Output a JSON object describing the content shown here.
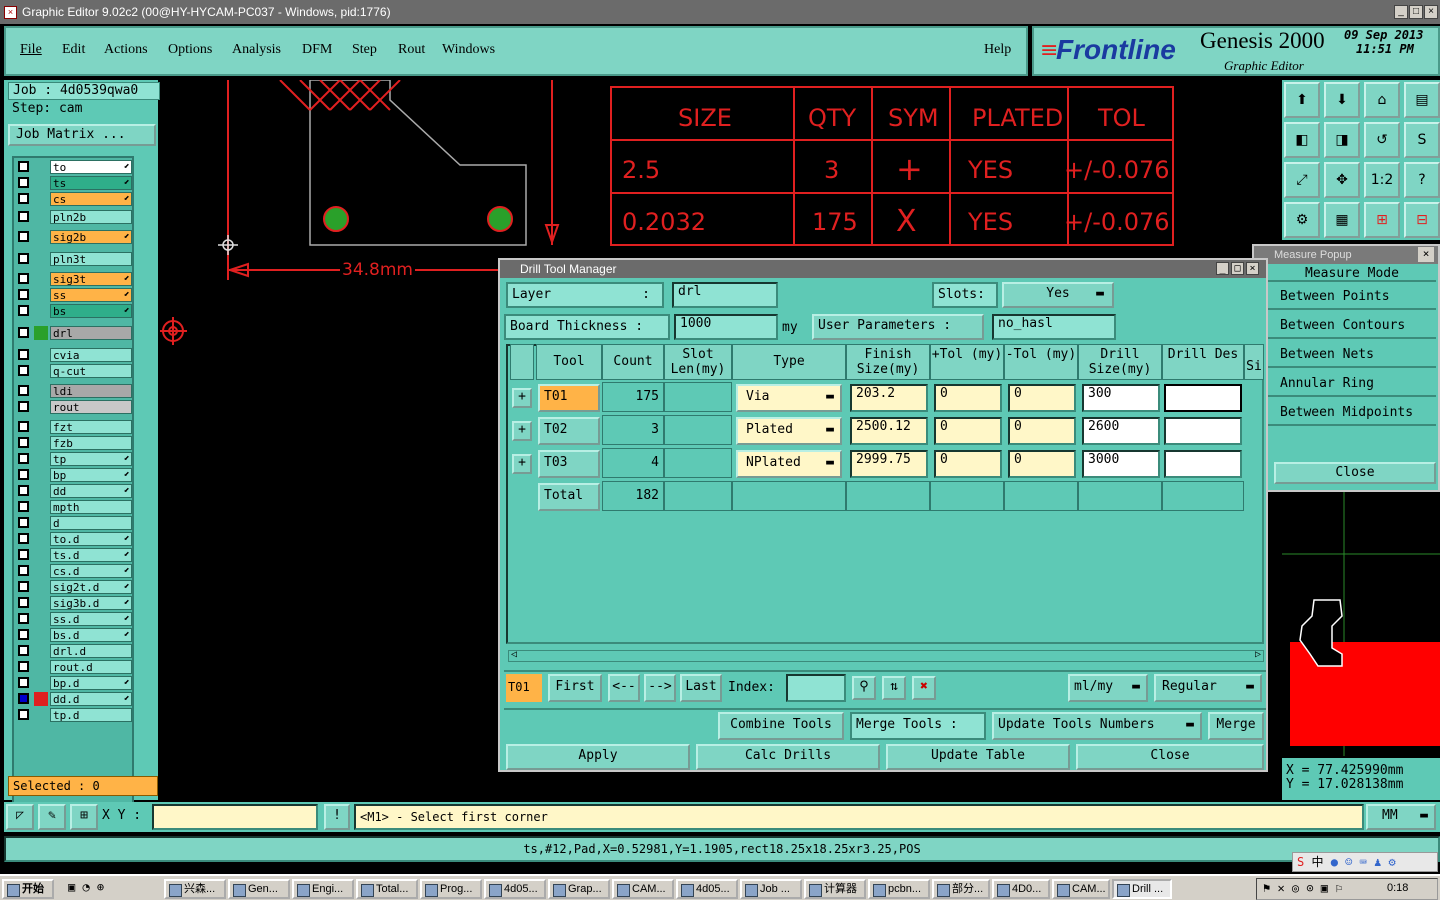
{
  "window": {
    "title": "Graphic Editor 9.02c2 (00@HY-HYCAM-PC037 - Windows, pid:1776)"
  },
  "menu": {
    "items": [
      "File",
      "Edit",
      "Actions",
      "Options",
      "Analysis",
      "DFM",
      "Step",
      "Rout",
      "Windows"
    ],
    "help": "Help"
  },
  "brand": {
    "logo": "Frontline",
    "product": "Genesis 2000",
    "subtitle": "Graphic Editor",
    "date": "09 Sep 2013",
    "time": "11:51 PM"
  },
  "job": {
    "job_line": "Job : 4d0539qwa0",
    "step_line": "Step: cam",
    "matrix_button": "Job Matrix ..."
  },
  "layers": [
    {
      "name": "to",
      "color": "#ffffff",
      "arrow": true
    },
    {
      "name": "ts",
      "color": "#2fae8a",
      "arrow": true
    },
    {
      "name": "cs",
      "color": "#ffb347",
      "arrow": true
    },
    {
      "name": "pln2b",
      "color": "",
      "arrow": false
    },
    {
      "name": "sig2b",
      "color": "#ffb347",
      "arrow": true
    },
    {
      "name": "pln3t",
      "color": "",
      "arrow": false
    },
    {
      "name": "sig3t",
      "color": "#ffb347",
      "arrow": true
    },
    {
      "name": "ss",
      "color": "#ffb347",
      "arrow": true
    },
    {
      "name": "bs",
      "color": "#2fae8a",
      "arrow": true
    },
    {
      "name": "drl",
      "color": "#a8a8a8",
      "arrow": false
    },
    {
      "name": "cvia",
      "color": "",
      "arrow": false
    },
    {
      "name": "q-cut",
      "color": "",
      "arrow": false
    },
    {
      "name": "ldi",
      "color": "#a8a8a8",
      "arrow": false
    },
    {
      "name": "rout",
      "color": "#c8c8c8",
      "arrow": false
    },
    {
      "name": "fzt",
      "color": "",
      "arrow": false
    },
    {
      "name": "fzb",
      "color": "",
      "arrow": false
    },
    {
      "name": "tp",
      "color": "",
      "arrow": true
    },
    {
      "name": "bp",
      "color": "",
      "arrow": true
    },
    {
      "name": "dd",
      "color": "",
      "arrow": true
    },
    {
      "name": "mpth",
      "color": "",
      "arrow": false
    },
    {
      "name": "d",
      "color": "",
      "arrow": false
    },
    {
      "name": "to.d",
      "color": "",
      "arrow": true
    },
    {
      "name": "ts.d",
      "color": "",
      "arrow": true
    },
    {
      "name": "cs.d",
      "color": "",
      "arrow": true
    },
    {
      "name": "sig2t.d",
      "color": "",
      "arrow": true
    },
    {
      "name": "sig3b.d",
      "color": "",
      "arrow": true
    },
    {
      "name": "ss.d",
      "color": "",
      "arrow": true
    },
    {
      "name": "bs.d",
      "color": "",
      "arrow": true
    },
    {
      "name": "drl.d",
      "color": "",
      "arrow": false
    },
    {
      "name": "rout.d",
      "color": "",
      "arrow": false
    },
    {
      "name": "bp.d",
      "color": "",
      "arrow": true
    },
    {
      "name": "dd.d",
      "color": "",
      "arrow": true
    },
    {
      "name": "tp.d",
      "color": "",
      "arrow": false
    }
  ],
  "selected": "Selected : 0",
  "drawing": {
    "dimension": "34.8mm",
    "table_headers": [
      "SIZE",
      "QTY",
      "SYM",
      "PLATED",
      "TOL"
    ],
    "table_rows": [
      [
        "2.5",
        "3",
        "+",
        "YES",
        "+/-0.076"
      ],
      [
        "0.2032",
        "175",
        "X",
        "YES",
        "+/-0.076"
      ]
    ]
  },
  "dtm": {
    "title": "Drill Tool Manager",
    "layer_label": "Layer",
    "layer_value": "drl",
    "slots_label": "Slots:",
    "slots_value": "Yes",
    "thickness_label": "Board Thickness :",
    "thickness_value": "1000",
    "thickness_unit": "my",
    "user_params_button": "User Parameters :",
    "user_params_value": "no_hasl",
    "columns": [
      "Tool",
      "Count",
      "Slot Len(my)",
      "Type",
      "Finish Size(my)",
      "+Tol (my)",
      "-Tol (my)",
      "Drill Size(my)",
      "Drill Des",
      "Si"
    ],
    "rows": [
      {
        "tool": "T01",
        "count": "175",
        "type": "Via",
        "finish": "203.2",
        "ptol": "0",
        "mtol": "0",
        "drill": "300"
      },
      {
        "tool": "T02",
        "count": "3",
        "type": "Plated",
        "finish": "2500.12",
        "ptol": "0",
        "mtol": "0",
        "drill": "2600"
      },
      {
        "tool": "T03",
        "count": "4",
        "type": "NPlated",
        "finish": "2999.75",
        "ptol": "0",
        "mtol": "0",
        "drill": "3000"
      }
    ],
    "total_label": "Total",
    "total_value": "182",
    "nav": {
      "current": "T01",
      "first": "First",
      "prev": "<--",
      "next": "-->",
      "last": "Last",
      "index_label": "Index:",
      "units": "ml/my",
      "mode": "Regular"
    },
    "actions": {
      "combine": "Combine Tools",
      "merge_label": "Merge Tools :",
      "update_numbers": "Update Tools Numbers",
      "merge": "Merge"
    },
    "bottom": {
      "apply": "Apply",
      "calc": "Calc Drills",
      "update_table": "Update Table",
      "close": "Close"
    }
  },
  "measure": {
    "title": "Measure Popup",
    "mode_label": "Measure Mode",
    "items": [
      "Between Points",
      "Between Contours",
      "Between Nets",
      "Annular Ring",
      "Between Midpoints"
    ],
    "close": "Close"
  },
  "coords": {
    "x": "X = 77.425990mm",
    "y": "Y = 17.028138mm"
  },
  "cmd": {
    "xy_label": "X Y :",
    "prompt": "<M1> - Select first corner",
    "units": "MM"
  },
  "status": "ts,#12,Pad,X=0.52981,Y=1.1905,rect18.25x18.25xr3.25,POS",
  "taskbar": {
    "start": "开始",
    "tasks": [
      "兴森...",
      "Gen...",
      "Engi...",
      "Total...",
      "Prog...",
      "4d05...",
      "Grap...",
      "CAM...",
      "4d05...",
      "Job ...",
      "计算器",
      "pcbn...",
      "部分...",
      "4D0...",
      "CAM...",
      "Drill ..."
    ],
    "clock": "0:18",
    "tray_ime": "中"
  }
}
